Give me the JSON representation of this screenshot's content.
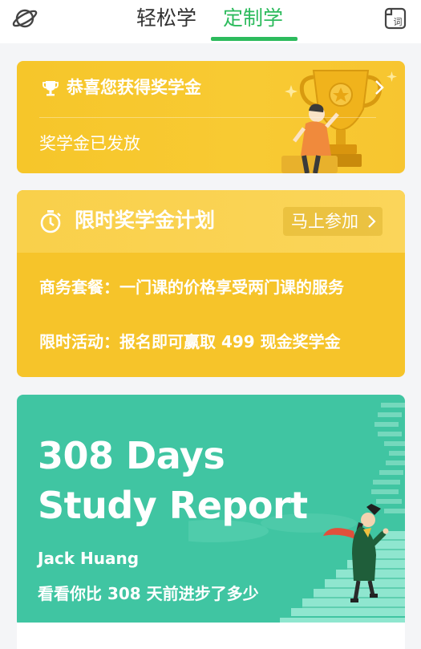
{
  "header": {
    "tabs": [
      {
        "label": "轻松学"
      },
      {
        "label": "定制学"
      }
    ],
    "active_tab": "定制学",
    "dict_icon_label": "词"
  },
  "scholarship_card": {
    "title": "恭喜您获得奖学金",
    "subtitle": "奖学金已发放"
  },
  "plan_card": {
    "title": "限时奖学金计划",
    "join_label": "马上参加",
    "line1": "商务套餐：一门课的价格享受两门课的服务",
    "line2": "限时活动：报名即可赢取 499 现金奖学金"
  },
  "report_card": {
    "headline1": "308 Days",
    "headline2": "Study Report",
    "name": "Jack Huang",
    "description": "看看你比 308 天前进步了多少"
  },
  "colors": {
    "accent_green": "#2dbb5d",
    "card_yellow": "#f6c42a",
    "report_green": "#40c5a2"
  },
  "icons": [
    "planet-icon",
    "dictionary-icon",
    "trophy-icon",
    "chevron-right-icon",
    "timer-icon",
    "trophy-illustration",
    "graduate-stairs-illustration"
  ]
}
